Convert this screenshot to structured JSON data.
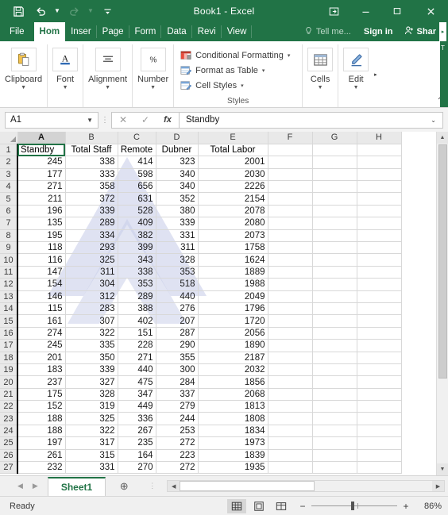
{
  "titlebar": {
    "document_title": "Book1 - Excel",
    "qat": [
      {
        "name": "save-icon",
        "label": "Save"
      },
      {
        "name": "undo-icon",
        "label": "Undo"
      },
      {
        "name": "redo-icon",
        "label": "Redo"
      },
      {
        "name": "customize-qat-icon",
        "label": "Customize Quick Access Toolbar"
      }
    ],
    "window_controls": [
      {
        "name": "ribbon-display-options-button",
        "glyph": "⬒"
      },
      {
        "name": "minimize-button",
        "glyph": "—"
      },
      {
        "name": "restore-button",
        "glyph": "⬜"
      },
      {
        "name": "close-button",
        "glyph": "✕"
      }
    ]
  },
  "ribbon_tabs": {
    "file": "File",
    "items": [
      {
        "label": "Hom",
        "active": true
      },
      {
        "label": "Inser",
        "active": false
      },
      {
        "label": "Page",
        "active": false
      },
      {
        "label": "Form",
        "active": false
      },
      {
        "label": "Data",
        "active": false
      },
      {
        "label": "Revi",
        "active": false
      },
      {
        "label": "View",
        "active": false
      }
    ],
    "tell_me": "Tell me...",
    "sign_in": "Sign in",
    "share": "Shar"
  },
  "ribbon": {
    "groups": [
      {
        "label": "Clipboard",
        "icon": "clipboard-icon"
      },
      {
        "label": "Font",
        "icon": "font-icon"
      },
      {
        "label": "Alignment",
        "icon": "alignment-icon"
      },
      {
        "label": "Number",
        "icon": "number-percent-icon"
      }
    ],
    "styles": {
      "title": "Styles",
      "items": [
        {
          "label": "Conditional Formatting",
          "icon": "conditional-formatting-icon"
        },
        {
          "label": "Format as Table",
          "icon": "format-as-table-icon"
        },
        {
          "label": "Cell Styles",
          "icon": "cell-styles-icon"
        }
      ]
    },
    "right_groups": [
      {
        "label": "Cells",
        "icon": "cells-icon"
      },
      {
        "label": "Edit",
        "icon": "editing-icon"
      }
    ]
  },
  "formula_bar": {
    "name_box": "A1",
    "cancel": "✕",
    "enter": "✓",
    "insert_function": "fx",
    "content": "Standby"
  },
  "grid": {
    "column_headers": [
      "A",
      "B",
      "C",
      "D",
      "E",
      "F",
      "G",
      "H"
    ],
    "selected_column": "A",
    "selected_cell": "A1",
    "header_row_number": "1",
    "headers": [
      "Standby",
      "Total Staff",
      "Remote",
      "Dubner",
      "Total Labor"
    ],
    "row_numbers": [
      "2",
      "3",
      "4",
      "5",
      "6",
      "7",
      "8",
      "9",
      "10",
      "11",
      "12",
      "13",
      "14",
      "15",
      "16",
      "17",
      "18",
      "19",
      "20",
      "21",
      "22",
      "23",
      "24",
      "25",
      "26",
      "27"
    ],
    "rows": [
      [
        "245",
        "338",
        "414",
        "323",
        "2001"
      ],
      [
        "177",
        "333",
        "598",
        "340",
        "2030"
      ],
      [
        "271",
        "358",
        "656",
        "340",
        "2226"
      ],
      [
        "211",
        "372",
        "631",
        "352",
        "2154"
      ],
      [
        "196",
        "339",
        "528",
        "380",
        "2078"
      ],
      [
        "135",
        "289",
        "409",
        "339",
        "2080"
      ],
      [
        "195",
        "334",
        "382",
        "331",
        "2073"
      ],
      [
        "118",
        "293",
        "399",
        "311",
        "1758"
      ],
      [
        "116",
        "325",
        "343",
        "328",
        "1624"
      ],
      [
        "147",
        "311",
        "338",
        "353",
        "1889"
      ],
      [
        "154",
        "304",
        "353",
        "518",
        "1988"
      ],
      [
        "146",
        "312",
        "289",
        "440",
        "2049"
      ],
      [
        "115",
        "283",
        "388",
        "276",
        "1796"
      ],
      [
        "161",
        "307",
        "402",
        "207",
        "1720"
      ],
      [
        "274",
        "322",
        "151",
        "287",
        "2056"
      ],
      [
        "245",
        "335",
        "228",
        "290",
        "1890"
      ],
      [
        "201",
        "350",
        "271",
        "355",
        "2187"
      ],
      [
        "183",
        "339",
        "440",
        "300",
        "2032"
      ],
      [
        "237",
        "327",
        "475",
        "284",
        "1856"
      ],
      [
        "175",
        "328",
        "347",
        "337",
        "2068"
      ],
      [
        "152",
        "319",
        "449",
        "279",
        "1813"
      ],
      [
        "188",
        "325",
        "336",
        "244",
        "1808"
      ],
      [
        "188",
        "322",
        "267",
        "253",
        "1834"
      ],
      [
        "197",
        "317",
        "235",
        "272",
        "1973"
      ],
      [
        "261",
        "315",
        "164",
        "223",
        "1839"
      ],
      [
        "232",
        "331",
        "270",
        "272",
        "1935"
      ]
    ]
  },
  "sheet_tabs": {
    "prev_arrow": "◀",
    "next_arrow": "▶",
    "tabs": [
      {
        "label": "Sheet1",
        "active": true
      }
    ],
    "add_sheet": "⊕",
    "overflow_dots": "⋮"
  },
  "status_bar": {
    "status": "Ready",
    "views": [
      {
        "name": "normal-view-button",
        "active": true
      },
      {
        "name": "page-layout-view-button",
        "active": false
      },
      {
        "name": "page-break-preview-button",
        "active": false
      }
    ],
    "zoom_out": "−",
    "zoom_in": "+",
    "zoom_level": "86%"
  },
  "colors": {
    "excel_green": "#217346",
    "watermark": "#c5cbe8"
  }
}
